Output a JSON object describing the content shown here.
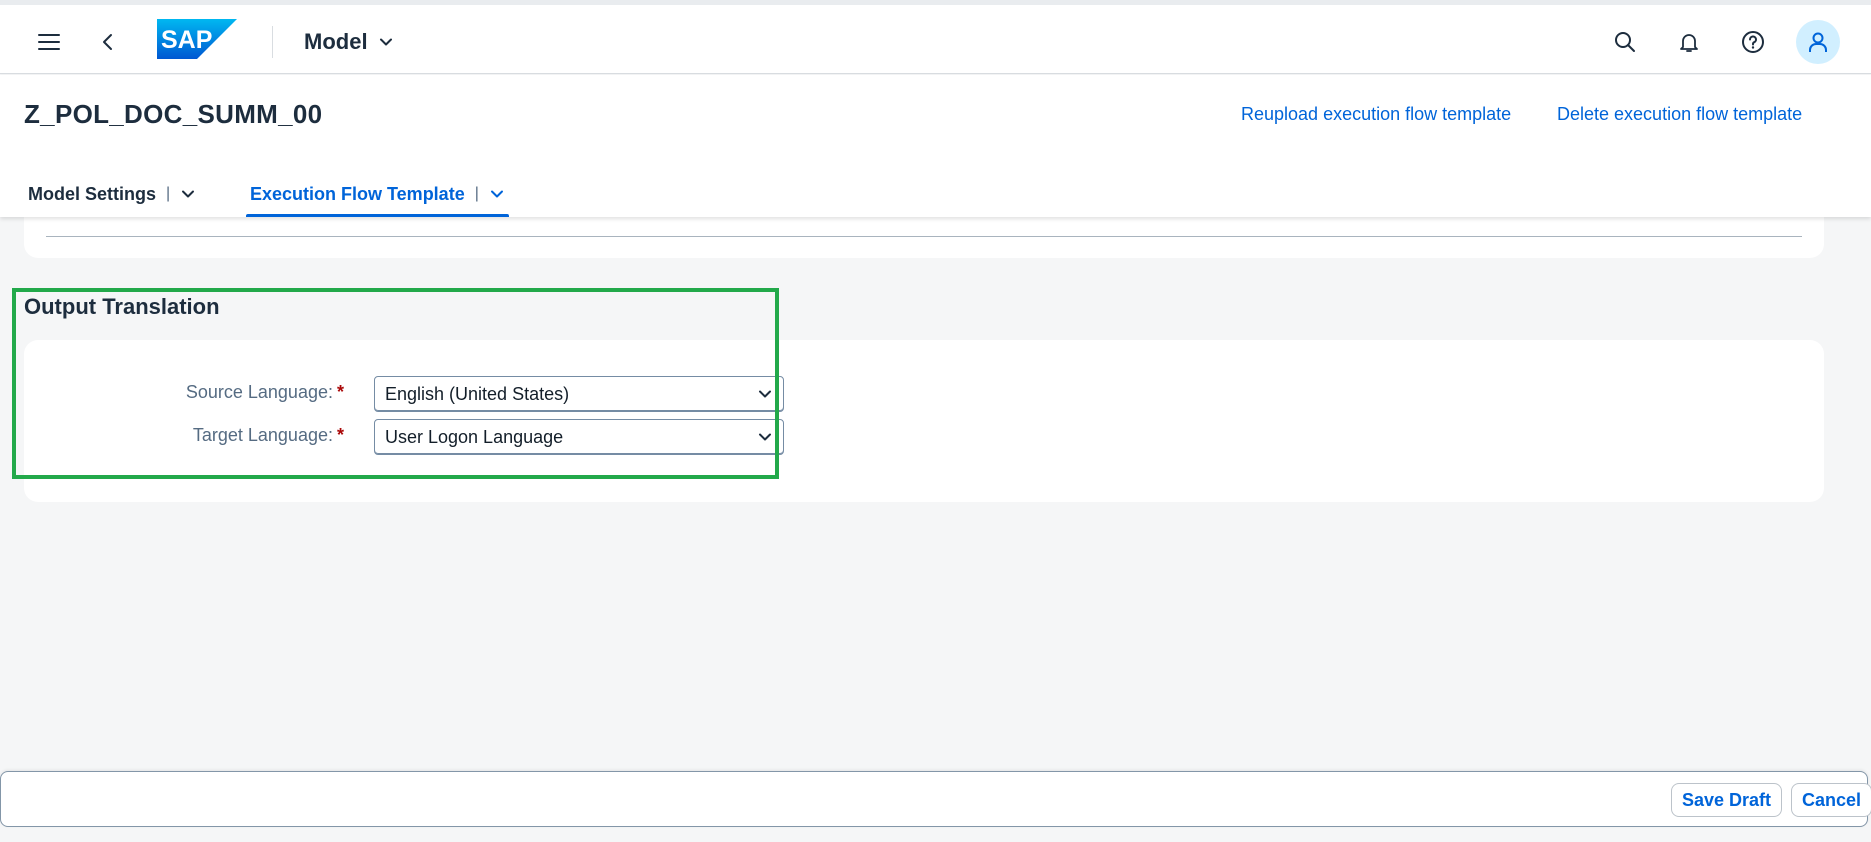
{
  "shell": {
    "logo_text": "SAP",
    "product_title": "Model",
    "icons": [
      "menu-icon",
      "back-icon",
      "search-icon",
      "bell-icon",
      "help-icon",
      "user-icon"
    ]
  },
  "header": {
    "object_title": "Z_POL_DOC_SUMM_00",
    "actions": {
      "reupload": "Reupload execution flow template",
      "delete": "Delete execution flow template"
    },
    "tabs": [
      {
        "label": "Model Settings",
        "separator": "|",
        "active": false
      },
      {
        "label": "Execution Flow Template",
        "separator": "|",
        "active": true
      }
    ]
  },
  "section": {
    "title": "Output Translation",
    "fields": [
      {
        "label": "Source Language:",
        "required": "*",
        "value": "English (United States)"
      },
      {
        "label": "Target Language:",
        "required": "*",
        "value": "User Logon Language"
      }
    ]
  },
  "footer": {
    "save_draft": "Save Draft",
    "cancel": "Cancel"
  },
  "colors": {
    "brand_blue": "#0064d9",
    "highlight_green": "#22a94a",
    "required_red": "#aa0808",
    "avatar_bg": "#d1efff"
  }
}
